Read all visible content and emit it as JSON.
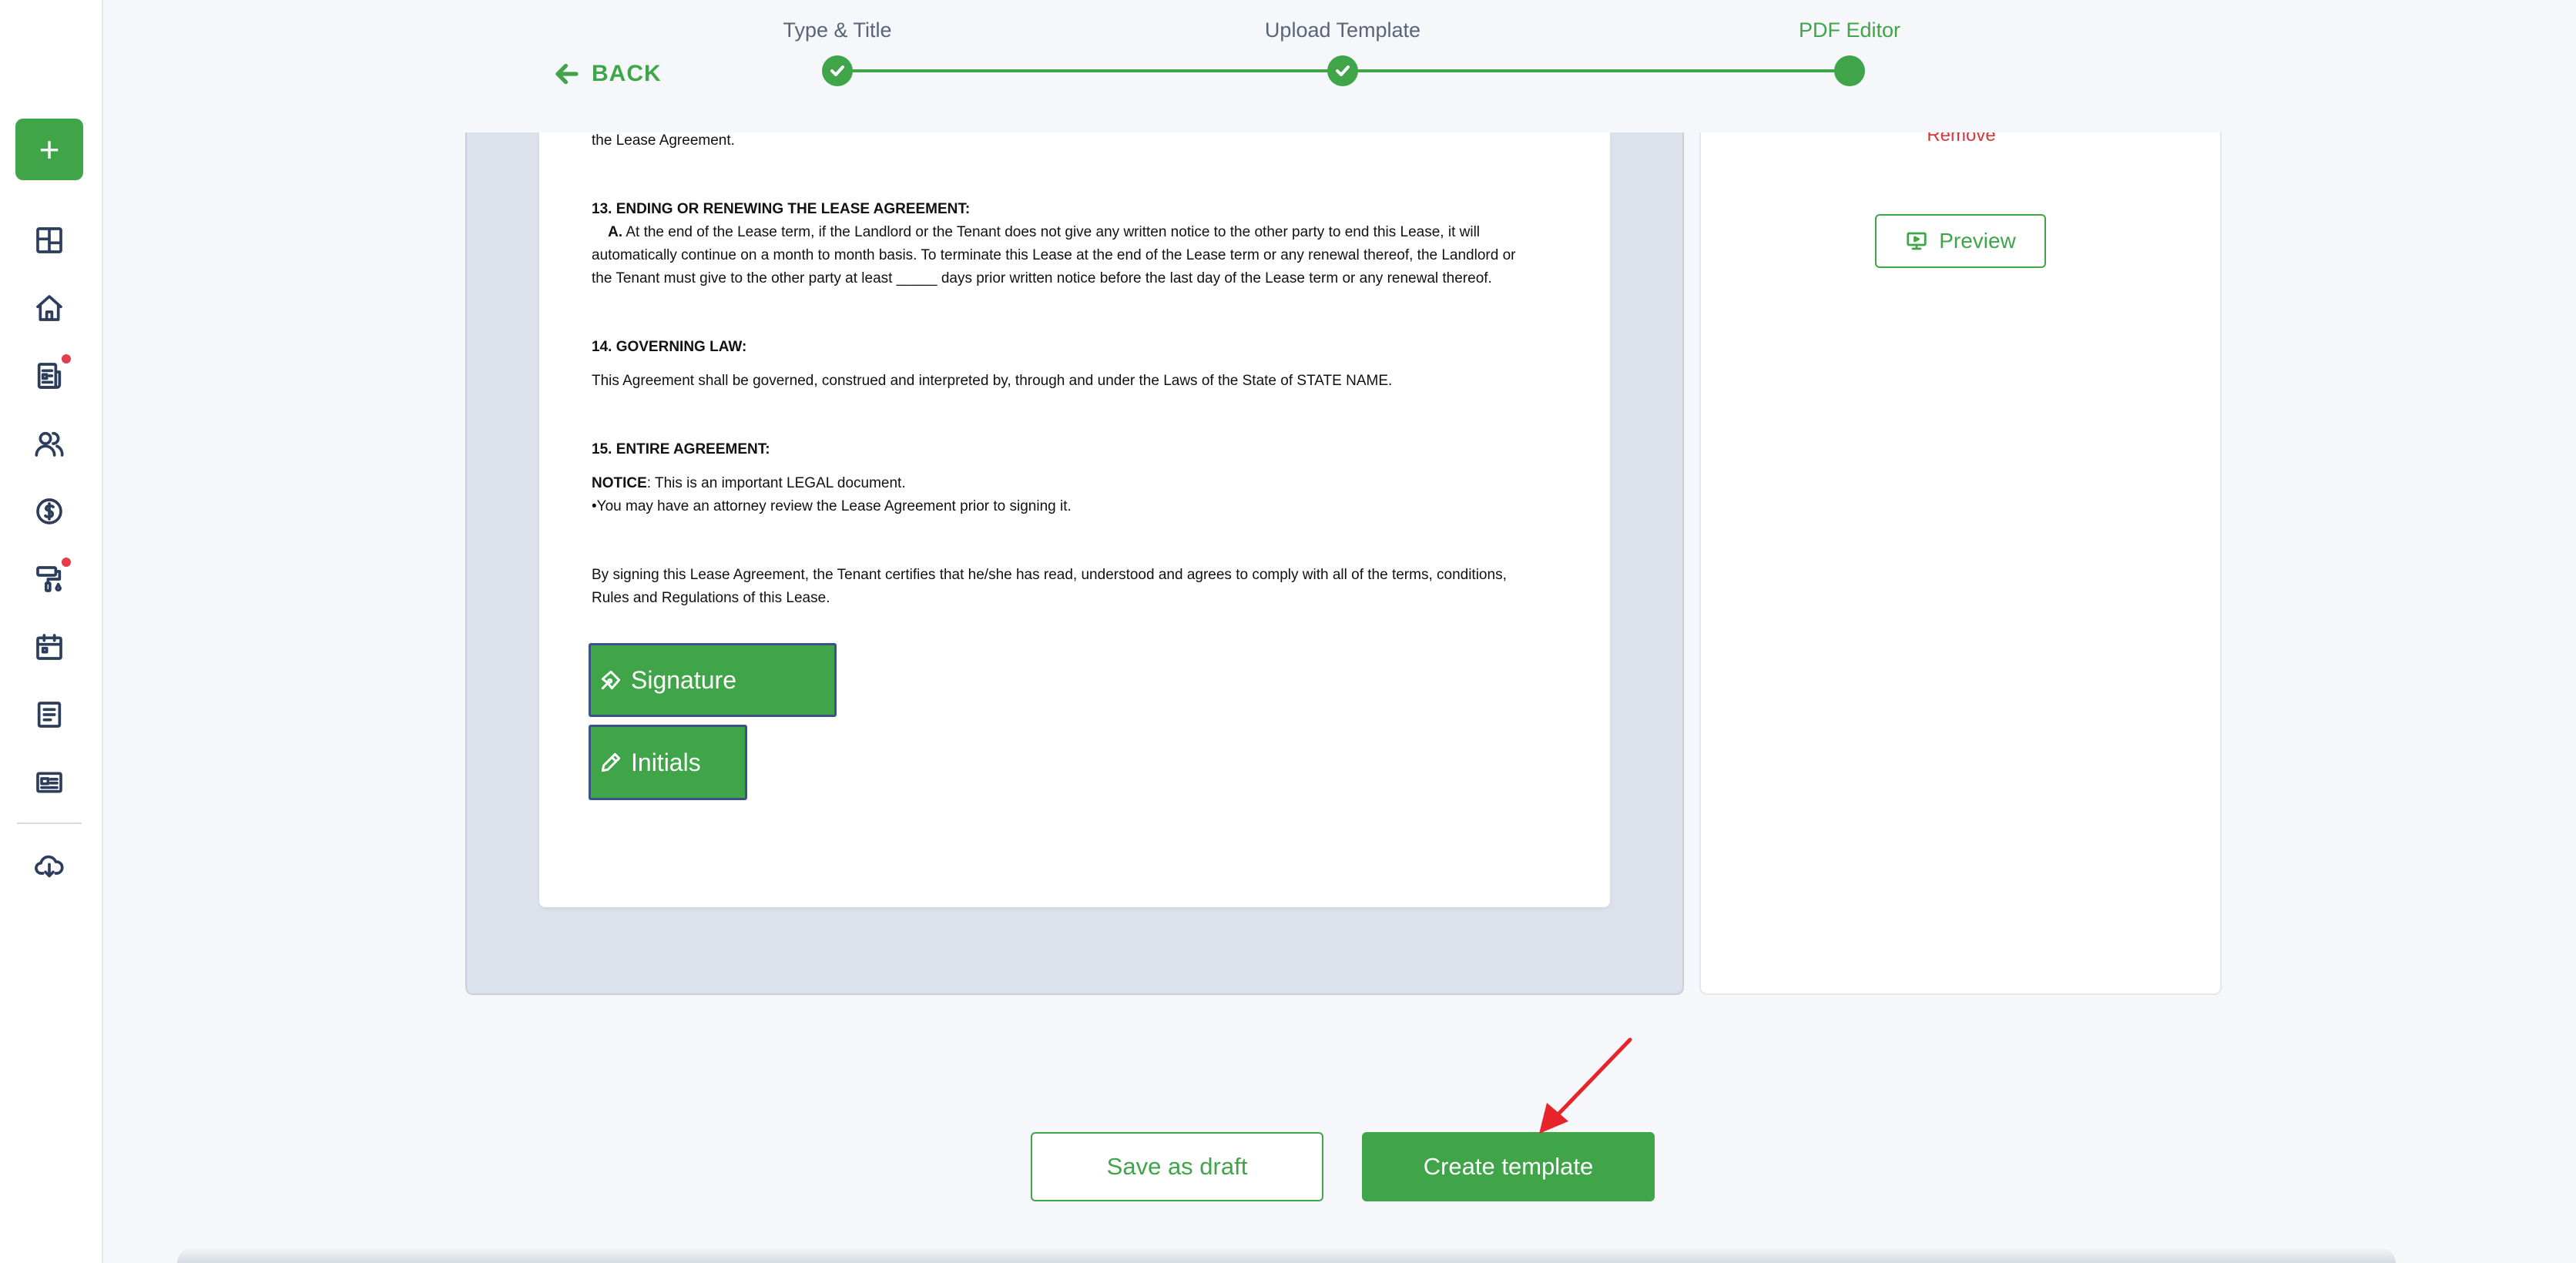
{
  "stepper": {
    "back_label": "BACK",
    "steps": [
      {
        "label": "Type & Title",
        "state": "complete"
      },
      {
        "label": "Upload Template",
        "state": "complete"
      },
      {
        "label": "PDF Editor",
        "state": "active"
      }
    ]
  },
  "sidebar": {
    "add_label": "+",
    "items": [
      {
        "icon": "dashboard-icon"
      },
      {
        "icon": "home-icon"
      },
      {
        "icon": "document-icon",
        "badge": true
      },
      {
        "icon": "users-icon"
      },
      {
        "icon": "dollar-icon"
      },
      {
        "icon": "paint-roller-icon",
        "badge": true
      },
      {
        "icon": "calendar-icon"
      },
      {
        "icon": "notes-icon"
      },
      {
        "icon": "id-card-icon"
      },
      {
        "icon": "cloud-download-icon"
      }
    ]
  },
  "document": {
    "line_prev": "the Lease Agreement.",
    "s13_heading": "13. ENDING OR RENEWING THE LEASE AGREEMENT:",
    "s13_a_label": "A.",
    "s13_line1": " At the end of the Lease term, if the Landlord or the Tenant does not give any written notice to the other party to end this Lease, it will",
    "s13_line2": "automatically continue on a month to month basis. To terminate this Lease at the end of the Lease term or any renewal thereof, the Landlord or",
    "s13_line3": "the Tenant must give to the other party at least _____ days prior written notice before the last day of the Lease term or any renewal thereof.",
    "s14_heading": "14. GOVERNING LAW:",
    "s14_text": "This Agreement shall be governed, construed and interpreted by, through and under the Laws of the State of STATE NAME.",
    "s15_heading": "15. ENTIRE AGREEMENT:",
    "notice_label": "NOTICE",
    "notice_text": ": This is an important LEGAL document.",
    "notice_bullet": "•You may have an attorney review the Lease Agreement prior to signing it.",
    "sign_line1": "By signing this Lease Agreement, the Tenant certifies that he/she has read, understood and agrees to comply with all of the terms, conditions,",
    "sign_line2": "Rules and Regulations of this Lease.",
    "signature_field": "Signature",
    "initials_field": "Initials"
  },
  "panel": {
    "remove_label": "Remove",
    "preview_label": "Preview"
  },
  "actions": {
    "save_draft_label": "Save as draft",
    "create_label": "Create template"
  },
  "colors": {
    "accent": "#3fa548",
    "danger": "#d9363e",
    "field_border": "#3b5288"
  }
}
